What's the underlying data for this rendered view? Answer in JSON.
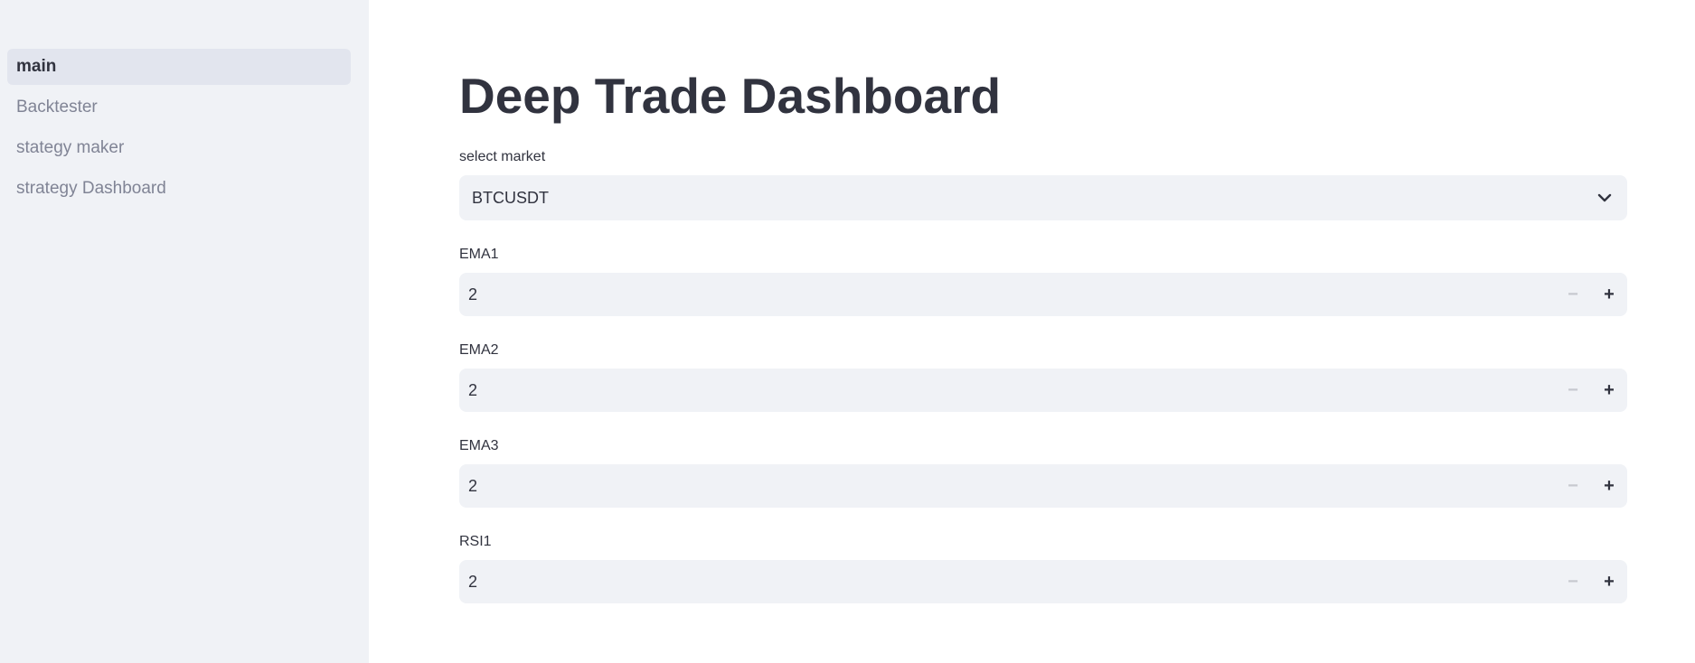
{
  "sidebar": {
    "items": [
      {
        "label": "main",
        "active": true
      },
      {
        "label": "Backtester",
        "active": false
      },
      {
        "label": "stategy maker",
        "active": false
      },
      {
        "label": "strategy Dashboard",
        "active": false
      }
    ]
  },
  "main": {
    "title": "Deep Trade Dashboard",
    "market_select": {
      "label": "select market",
      "value": "BTCUSDT",
      "icon": "chevron-down-icon"
    },
    "inputs": [
      {
        "label": "EMA1",
        "value": "2"
      },
      {
        "label": "EMA2",
        "value": "2"
      },
      {
        "label": "EMA3",
        "value": "2"
      },
      {
        "label": "RSI1",
        "value": "2"
      }
    ],
    "stepper": {
      "minus": "−",
      "plus": "+"
    }
  },
  "colors": {
    "sidebar_bg": "#f0f2f6",
    "active_item_bg": "#e2e5ee",
    "text": "#31333f",
    "muted_text": "#808495",
    "input_bg": "#f0f2f6"
  }
}
